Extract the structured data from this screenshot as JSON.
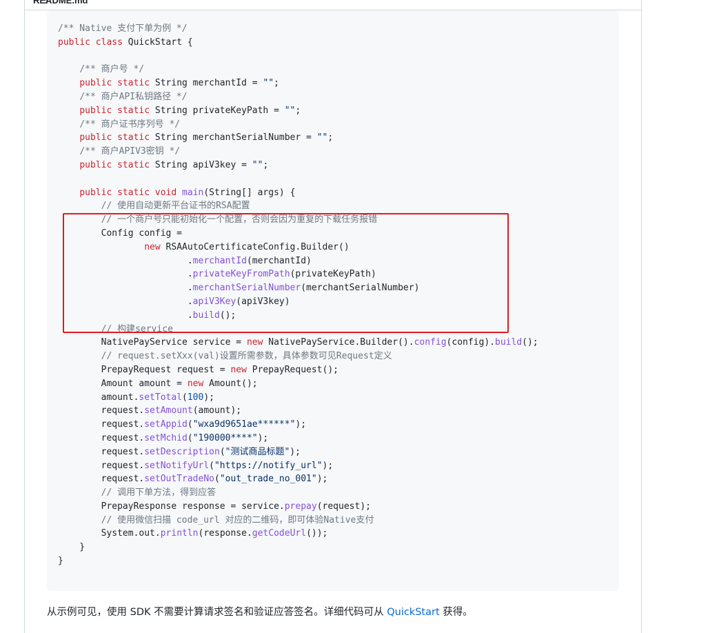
{
  "header": {
    "title": "README.md",
    "icon": "list-unordered-icon"
  },
  "code": {
    "language": "java",
    "lines": [
      [
        {
          "t": "/** Native 支付下单为例 */",
          "c": "cm"
        }
      ],
      [
        {
          "t": "public class",
          "c": "kw"
        },
        {
          "t": " QuickStart {"
        }
      ],
      [],
      [
        {
          "t": "    "
        },
        {
          "t": "/** 商户号 */",
          "c": "cm"
        }
      ],
      [
        {
          "t": "    "
        },
        {
          "t": "public static",
          "c": "kw"
        },
        {
          "t": " String merchantId = "
        },
        {
          "t": "\"\"",
          "c": "st"
        },
        {
          "t": ";"
        }
      ],
      [
        {
          "t": "    "
        },
        {
          "t": "/** 商户API私钥路径 */",
          "c": "cm"
        }
      ],
      [
        {
          "t": "    "
        },
        {
          "t": "public static",
          "c": "kw"
        },
        {
          "t": " String privateKeyPath = "
        },
        {
          "t": "\"\"",
          "c": "st"
        },
        {
          "t": ";"
        }
      ],
      [
        {
          "t": "    "
        },
        {
          "t": "/** 商户证书序列号 */",
          "c": "cm"
        }
      ],
      [
        {
          "t": "    "
        },
        {
          "t": "public static",
          "c": "kw"
        },
        {
          "t": " String merchantSerialNumber = "
        },
        {
          "t": "\"\"",
          "c": "st"
        },
        {
          "t": ";"
        }
      ],
      [
        {
          "t": "    "
        },
        {
          "t": "/** 商户APIV3密钥 */",
          "c": "cm"
        }
      ],
      [
        {
          "t": "    "
        },
        {
          "t": "public static",
          "c": "kw"
        },
        {
          "t": " String apiV3key = "
        },
        {
          "t": "\"\"",
          "c": "st"
        },
        {
          "t": ";"
        }
      ],
      [],
      [
        {
          "t": "    "
        },
        {
          "t": "public static void",
          "c": "kw"
        },
        {
          "t": " "
        },
        {
          "t": "main",
          "c": "fn"
        },
        {
          "t": "(String[] args) {"
        }
      ],
      [
        {
          "t": "        "
        },
        {
          "t": "// 使用自动更新平台证书的RSA配置",
          "c": "cm"
        }
      ],
      [
        {
          "t": "        "
        },
        {
          "t": "// 一个商户号只能初始化一个配置，否则会因为重复的下载任务报错",
          "c": "cm"
        }
      ],
      [
        {
          "t": "        Config config ="
        }
      ],
      [
        {
          "t": "                "
        },
        {
          "t": "new",
          "c": "kw"
        },
        {
          "t": " RSAAutoCertificateConfig.Builder()"
        }
      ],
      [
        {
          "t": "                        ."
        },
        {
          "t": "merchantId",
          "c": "fn"
        },
        {
          "t": "(merchantId)"
        }
      ],
      [
        {
          "t": "                        ."
        },
        {
          "t": "privateKeyFromPath",
          "c": "fn"
        },
        {
          "t": "(privateKeyPath)"
        }
      ],
      [
        {
          "t": "                        ."
        },
        {
          "t": "merchantSerialNumber",
          "c": "fn"
        },
        {
          "t": "(merchantSerialNumber)"
        }
      ],
      [
        {
          "t": "                        ."
        },
        {
          "t": "apiV3Key",
          "c": "fn"
        },
        {
          "t": "(apiV3key)"
        }
      ],
      [
        {
          "t": "                        ."
        },
        {
          "t": "build",
          "c": "fn"
        },
        {
          "t": "();"
        }
      ],
      [
        {
          "t": "        "
        },
        {
          "t": "// 构建service",
          "c": "cm"
        }
      ],
      [
        {
          "t": "        NativePayService service = "
        },
        {
          "t": "new",
          "c": "kw"
        },
        {
          "t": " NativePayService.Builder()."
        },
        {
          "t": "config",
          "c": "fn"
        },
        {
          "t": "(config)."
        },
        {
          "t": "build",
          "c": "fn"
        },
        {
          "t": "();"
        }
      ],
      [
        {
          "t": "        "
        },
        {
          "t": "// request.setXxx(val)设置所需参数，具体参数可见Request定义",
          "c": "cm"
        }
      ],
      [
        {
          "t": "        PrepayRequest request = "
        },
        {
          "t": "new",
          "c": "kw"
        },
        {
          "t": " PrepayRequest();"
        }
      ],
      [
        {
          "t": "        Amount amount = "
        },
        {
          "t": "new",
          "c": "kw"
        },
        {
          "t": " Amount();"
        }
      ],
      [
        {
          "t": "        amount."
        },
        {
          "t": "setTotal",
          "c": "fn"
        },
        {
          "t": "("
        },
        {
          "t": "100",
          "c": "nm"
        },
        {
          "t": ");"
        }
      ],
      [
        {
          "t": "        request."
        },
        {
          "t": "setAmount",
          "c": "fn"
        },
        {
          "t": "(amount);"
        }
      ],
      [
        {
          "t": "        request."
        },
        {
          "t": "setAppid",
          "c": "fn"
        },
        {
          "t": "("
        },
        {
          "t": "\"wxa9d9651ae******\"",
          "c": "st"
        },
        {
          "t": ");"
        }
      ],
      [
        {
          "t": "        request."
        },
        {
          "t": "setMchid",
          "c": "fn"
        },
        {
          "t": "("
        },
        {
          "t": "\"190000****\"",
          "c": "st"
        },
        {
          "t": ");"
        }
      ],
      [
        {
          "t": "        request."
        },
        {
          "t": "setDescription",
          "c": "fn"
        },
        {
          "t": "("
        },
        {
          "t": "\"测试商品标题\"",
          "c": "st"
        },
        {
          "t": ");"
        }
      ],
      [
        {
          "t": "        request."
        },
        {
          "t": "setNotifyUrl",
          "c": "fn"
        },
        {
          "t": "("
        },
        {
          "t": "\"https://notify_url\"",
          "c": "st"
        },
        {
          "t": ");"
        }
      ],
      [
        {
          "t": "        request."
        },
        {
          "t": "setOutTradeNo",
          "c": "fn"
        },
        {
          "t": "("
        },
        {
          "t": "\"out_trade_no_001\"",
          "c": "st"
        },
        {
          "t": ");"
        }
      ],
      [
        {
          "t": "        "
        },
        {
          "t": "// 调用下单方法，得到应答",
          "c": "cm"
        }
      ],
      [
        {
          "t": "        PrepayResponse response = service."
        },
        {
          "t": "prepay",
          "c": "fn"
        },
        {
          "t": "(request);"
        }
      ],
      [
        {
          "t": "        "
        },
        {
          "t": "// 使用微信扫描 code_url 对应的二维码，即可体验Native支付",
          "c": "cm"
        }
      ],
      [
        {
          "t": "        System.out."
        },
        {
          "t": "println",
          "c": "fn"
        },
        {
          "t": "(response."
        },
        {
          "t": "getCodeUrl",
          "c": "fn"
        },
        {
          "t": "());"
        }
      ],
      [
        {
          "t": "    }"
        }
      ],
      [
        {
          "t": "}"
        }
      ]
    ]
  },
  "description": {
    "before": "从示例可见，使用 SDK 不需要计算请求签名和验证应答签名。详细代码可从 ",
    "link": "QuickStart",
    "after": " 获得。"
  },
  "colors": {
    "keyword": "#cf222e",
    "comment": "#6e7781",
    "function": "#8250df",
    "string": "#0a3069",
    "number": "#0550ae",
    "link": "#0969da",
    "highlight_box": "#e5181e"
  }
}
